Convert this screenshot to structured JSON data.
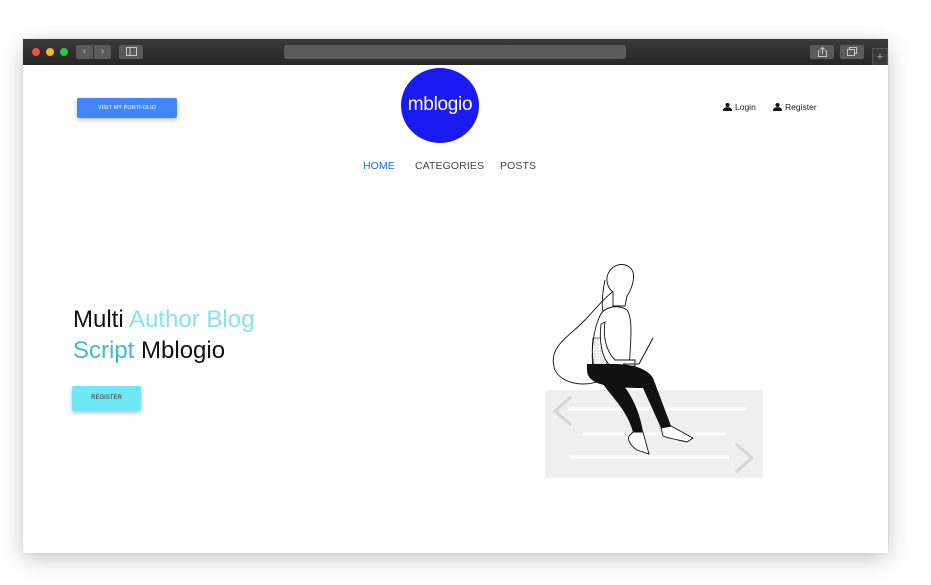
{
  "browser": {
    "traffic_lights": [
      "close",
      "minimize",
      "zoom"
    ],
    "nav_back_glyph": "‹",
    "nav_forward_glyph": "›",
    "new_tab_glyph": "+",
    "icons": [
      "sidebar-icon",
      "share-icon",
      "tabs-icon"
    ]
  },
  "header": {
    "portfolio_button": "VISIT MY PORTFOLIO",
    "logo_text": "mblogio",
    "login_link": "Login",
    "register_link": "Register",
    "logo_color": "#1a1af2"
  },
  "nav": {
    "items": [
      {
        "label": "HOME",
        "active": true
      },
      {
        "label": "CATEGORIES",
        "active": false
      },
      {
        "label": "POSTS",
        "active": false
      }
    ],
    "active_color": "#1e6fe0"
  },
  "hero": {
    "title_part1": "Multi ",
    "title_highlight1": "Author Blog",
    "title_highlight2": "Script",
    "title_part2": " Mblogio",
    "register_button": "REGISTER",
    "accent_colors": [
      "#84e2f2",
      "#42b8d6"
    ]
  },
  "illustration": {
    "icon": "woman-with-laptop-illustration"
  }
}
